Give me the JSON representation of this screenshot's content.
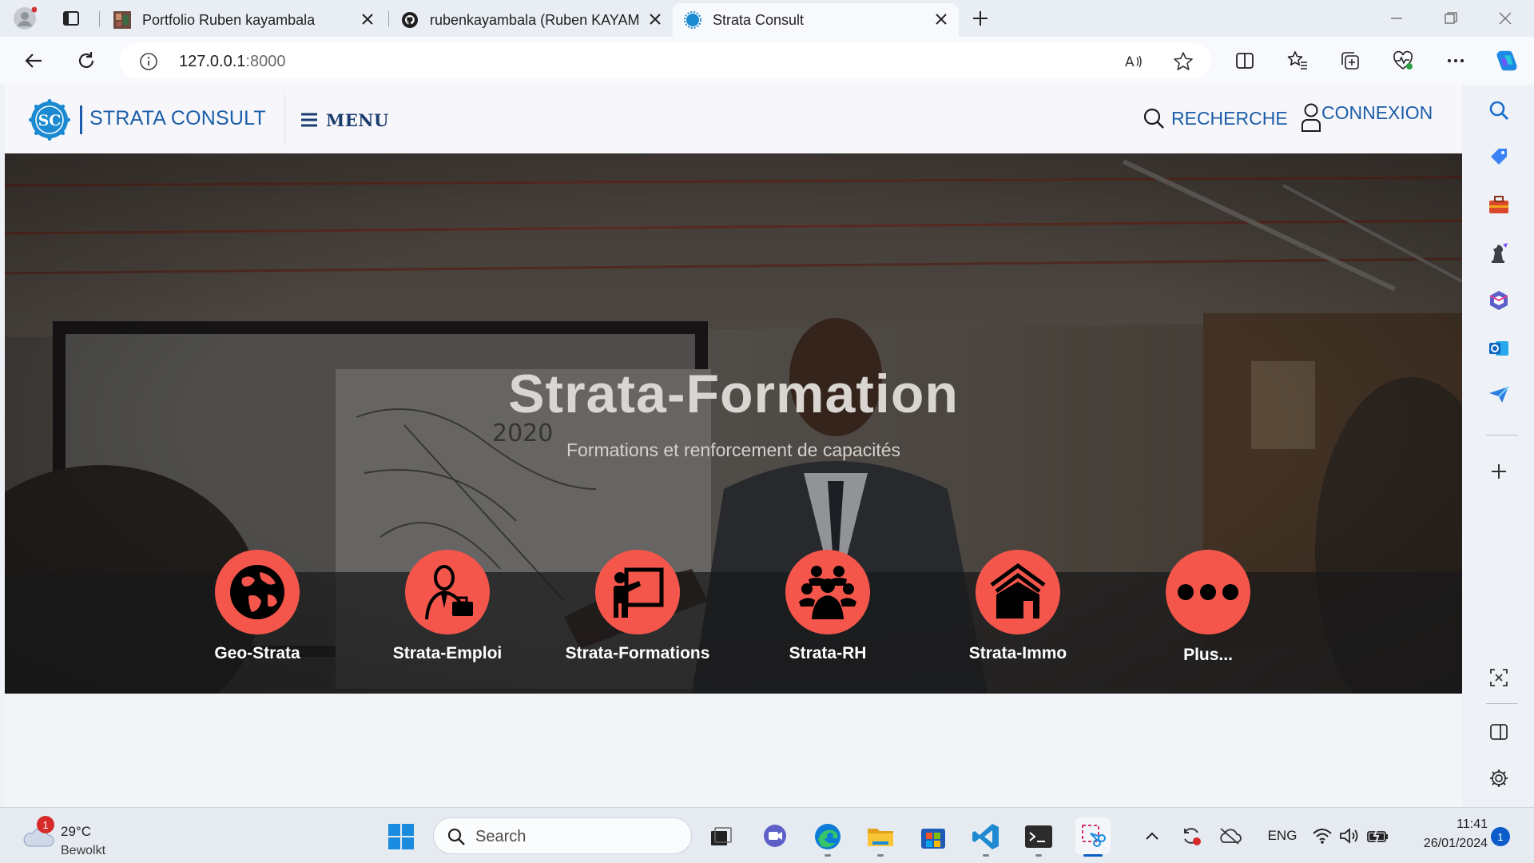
{
  "browser": {
    "tabs": [
      {
        "title": "Portfolio Ruben kayambala"
      },
      {
        "title": "rubenkayambala (Ruben KAYAMBALA)"
      },
      {
        "title": "Strata Consult"
      }
    ],
    "address": {
      "host": "127.0.0.1",
      "port": ":8000"
    }
  },
  "site": {
    "name": "STRATA CONSULT",
    "logo_text": "SC",
    "menu_label": "MENU",
    "search_label": "RECHERCHE",
    "login_label": "CONNEXION"
  },
  "hero": {
    "title": "Strata-Formation",
    "subtitle": "Formations et renforcement de capacités"
  },
  "services": [
    {
      "label": "Geo-Strata",
      "icon": "globe-icon"
    },
    {
      "label": "Strata-Emploi",
      "icon": "employee-icon"
    },
    {
      "label": "Strata-Formations",
      "icon": "teacher-board-icon"
    },
    {
      "label": "Strata-RH",
      "icon": "group-icon"
    },
    {
      "label": "Strata-Immo",
      "icon": "house-icon"
    },
    {
      "label": "Plus...",
      "icon": "more-dots-icon"
    }
  ],
  "colors": {
    "brand_blue": "#1b5da8",
    "service_red": "#f4564c"
  },
  "taskbar": {
    "weather_temp": "29°C",
    "weather_condition": "Bewolkt",
    "weather_badge": "1",
    "search_label": "Search",
    "language": "ENG",
    "time": "11:41",
    "date": "26/01/2024",
    "notification_count": "1"
  }
}
